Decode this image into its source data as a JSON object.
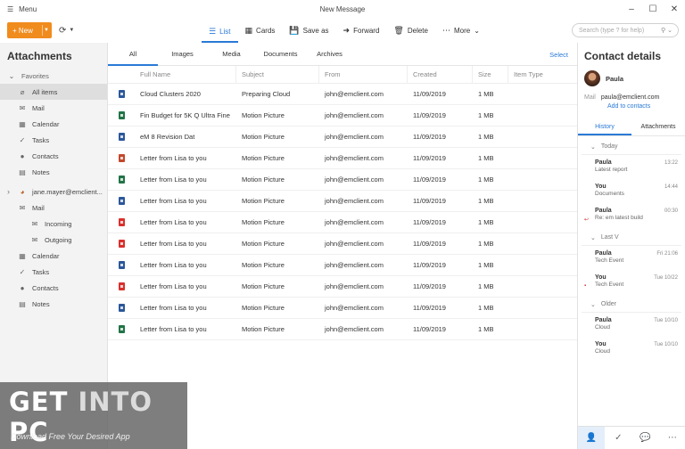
{
  "titlebar": {
    "menu_label": "Menu",
    "window_title": "New Message",
    "controls": [
      "–",
      "☐",
      "✕"
    ]
  },
  "toolbar": {
    "new_label": "+ New",
    "sync_icon": "sync-icon",
    "items": [
      {
        "label": "List",
        "icon": "list-icon",
        "active": true
      },
      {
        "label": "Cards",
        "icon": "cards-icon"
      },
      {
        "label": "Save as",
        "icon": "save-icon"
      },
      {
        "label": "Forward",
        "icon": "forward-icon"
      },
      {
        "label": "Delete",
        "icon": "trash-icon"
      },
      {
        "label": "More",
        "icon": "more-icon"
      }
    ],
    "search_placeholder": "Search (type ? for help)"
  },
  "sidebar": {
    "title": "Attachments",
    "items": [
      {
        "label": "Favorites",
        "icon": "chevron-down-icon",
        "glyph": "⌄",
        "indent": 8,
        "type": "group"
      },
      {
        "label": "All items",
        "icon": "paperclip-icon",
        "glyph": "⌀",
        "indent": 20,
        "selected": true
      },
      {
        "label": "Mail",
        "icon": "mail-icon",
        "glyph": "✉",
        "indent": 20
      },
      {
        "label": "Calendar",
        "icon": "calendar-icon",
        "glyph": "▦",
        "indent": 20
      },
      {
        "label": "Tasks",
        "icon": "check-icon",
        "glyph": "✓",
        "indent": 20
      },
      {
        "label": "Contacts",
        "icon": "person-icon",
        "glyph": "●",
        "indent": 20
      },
      {
        "label": "Notes",
        "icon": "note-icon",
        "glyph": "▤",
        "indent": 20
      },
      {
        "label": "jane.mayer@emclient...",
        "icon": "account-avatar-icon",
        "glyph": "◕",
        "indent": 20,
        "type": "account"
      },
      {
        "label": "Mail",
        "icon": "mail-icon",
        "glyph": "✉",
        "indent": 20
      },
      {
        "label": "Incoming",
        "icon": "inbox-icon",
        "glyph": "✉",
        "indent": 34
      },
      {
        "label": "Outgoing",
        "icon": "outbox-icon",
        "glyph": "✉",
        "indent": 34
      },
      {
        "label": "Calendar",
        "icon": "calendar-icon",
        "glyph": "▦",
        "indent": 20
      },
      {
        "label": "Tasks",
        "icon": "check-icon",
        "glyph": "✓",
        "indent": 20
      },
      {
        "label": "Contacts",
        "icon": "person-icon",
        "glyph": "●",
        "indent": 20
      },
      {
        "label": "Notes",
        "icon": "note-icon",
        "glyph": "▤",
        "indent": 20
      }
    ]
  },
  "main": {
    "tabs": [
      "All",
      "Images",
      "Media",
      "Documents",
      "Archives"
    ],
    "select_label": "Select",
    "columns": [
      "Full Name",
      "Subject",
      "From",
      "Created",
      "Size",
      "Item Type"
    ],
    "rows": [
      {
        "type": "word",
        "name": "Cloud Clusters 2020",
        "subject": "Preparing Cloud",
        "from": "john@emclient.com",
        "created": "11/09/2019",
        "size": "1 MB"
      },
      {
        "type": "excel",
        "name": "Fin Budget for 5K Q Ultra Fine",
        "subject": "Motion Picture",
        "from": "john@emclient.com",
        "created": "11/09/2019",
        "size": "1 MB"
      },
      {
        "type": "word",
        "name": "eM 8 Revision Dat",
        "subject": "Motion Picture",
        "from": "john@emclient.com",
        "created": "11/09/2019",
        "size": "1 MB"
      },
      {
        "type": "ppt",
        "name": "Letter from Lisa to you",
        "subject": "Motion Picture",
        "from": "john@emclient.com",
        "created": "11/09/2019",
        "size": "1 MB"
      },
      {
        "type": "excel",
        "name": "Letter from Lisa to you",
        "subject": "Motion Picture",
        "from": "john@emclient.com",
        "created": "11/09/2019",
        "size": "1 MB"
      },
      {
        "type": "word",
        "name": "Letter from Lisa to you",
        "subject": "Motion Picture",
        "from": "john@emclient.com",
        "created": "11/09/2019",
        "size": "1 MB"
      },
      {
        "type": "pdf",
        "name": "Letter from Lisa to you",
        "subject": "Motion Picture",
        "from": "john@emclient.com",
        "created": "11/09/2019",
        "size": "1 MB"
      },
      {
        "type": "pdf",
        "name": "Letter from Lisa to you",
        "subject": "Motion Picture",
        "from": "john@emclient.com",
        "created": "11/09/2019",
        "size": "1 MB"
      },
      {
        "type": "word",
        "name": "Letter from Lisa to you",
        "subject": "Motion Picture",
        "from": "john@emclient.com",
        "created": "11/09/2019",
        "size": "1 MB"
      },
      {
        "type": "pdf",
        "name": "Letter from Lisa to you",
        "subject": "Motion Picture",
        "from": "john@emclient.com",
        "created": "11/09/2019",
        "size": "1 MB"
      },
      {
        "type": "word",
        "name": "Letter from Lisa to you",
        "subject": "Motion Picture",
        "from": "john@emclient.com",
        "created": "11/09/2019",
        "size": "1 MB"
      },
      {
        "type": "excel",
        "name": "Letter from Lisa to you",
        "subject": "Motion Picture",
        "from": "john@emclient.com",
        "created": "11/09/2019",
        "size": "1 MB"
      }
    ],
    "file_colors": {
      "word": "#2b579a",
      "excel": "#217346",
      "ppt": "#c4472b",
      "pdf": "#d9302c"
    }
  },
  "contact": {
    "title": "Contact details",
    "name": "Paula",
    "mail_label": "Mail",
    "email": "paula@emclient.com",
    "add_label": "Add to contacts",
    "tabs": [
      "History",
      "Attachments"
    ],
    "groups": [
      {
        "label": "Today",
        "items": [
          {
            "name": "Paula",
            "sub": "Latest report",
            "time": "13:22"
          },
          {
            "name": "You",
            "sub": "Documents",
            "time": "14:44"
          },
          {
            "name": "Paula",
            "sub": "Re: em latest build",
            "time": "00:30",
            "reply": true
          }
        ]
      },
      {
        "label": "Last V",
        "items": [
          {
            "name": "Paula",
            "sub": "Tech Event",
            "time": "Fri 21:06"
          },
          {
            "name": "You",
            "sub": "Tech Event",
            "time": "Tue 10/22",
            "flag": true
          }
        ]
      },
      {
        "label": "Older",
        "items": [
          {
            "name": "Paula",
            "sub": "Cloud",
            "time": "Tue 10/10"
          },
          {
            "name": "You",
            "sub": "Cloud",
            "time": "Tue 10/10"
          }
        ]
      }
    ],
    "footer_icons": [
      "person-icon",
      "check-icon",
      "chat-icon",
      "more-icon"
    ]
  },
  "watermark": {
    "get": "GET ",
    "into": "INTO",
    "pc": " PC",
    "tagline": "Download Free Your Desired App"
  }
}
